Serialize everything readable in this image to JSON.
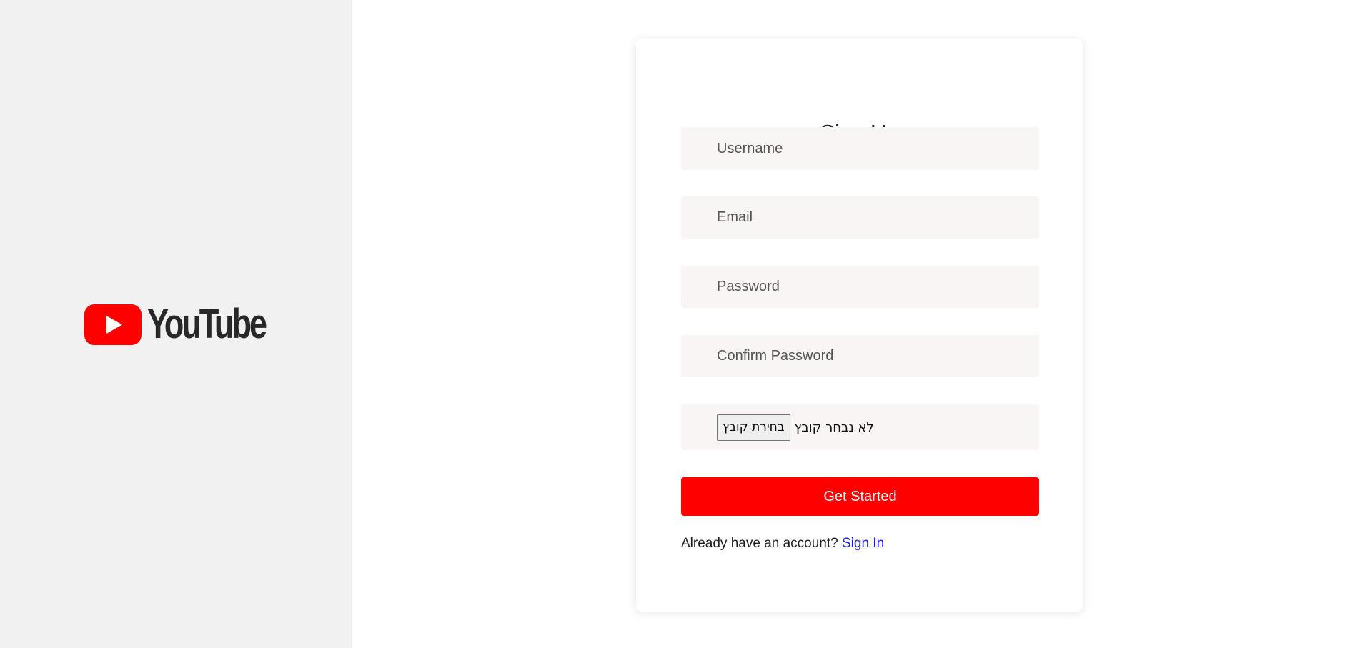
{
  "brand": {
    "logo_text": "YouTube",
    "logo_red": "#ff0000",
    "logo_text_color": "#282828"
  },
  "form": {
    "title": "Sign Up",
    "fields": {
      "username": {
        "placeholder": "Username",
        "value": ""
      },
      "email": {
        "placeholder": "Email",
        "value": ""
      },
      "password": {
        "placeholder": "Password",
        "value": ""
      },
      "confirm_password": {
        "placeholder": "Confirm Password",
        "value": ""
      }
    },
    "file_input": {
      "button_label": "בחירת קובץ",
      "status_text": "לא נבחר קובץ"
    },
    "submit_label": "Get Started",
    "signin_prompt": "Already have an account?",
    "signin_link": "Sign In"
  },
  "colors": {
    "accent": "#ff0000",
    "link": "#1a1aff",
    "field_bg": "#f8f5f4",
    "left_panel_bg": "#f1f1f1"
  }
}
